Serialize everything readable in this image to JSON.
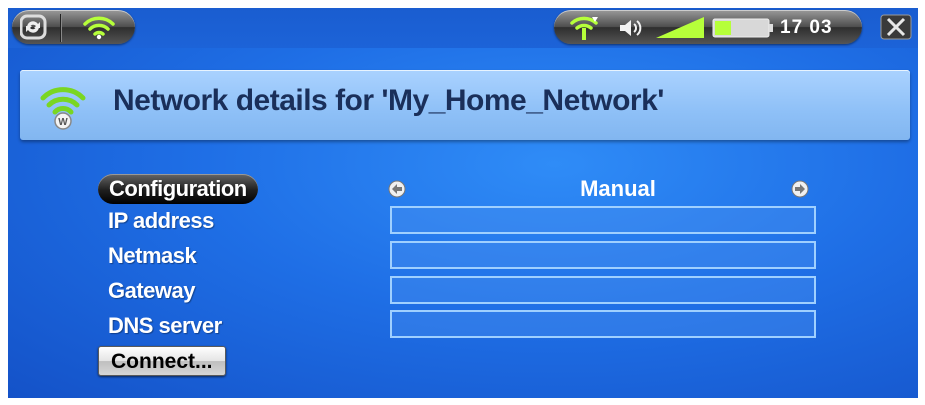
{
  "status_bar": {
    "left_icons": [
      "sync-icon",
      "wifi-icon"
    ],
    "right_icons": [
      "wifi-connected-icon",
      "volume-icon",
      "signal-level-icon",
      "battery-icon"
    ],
    "clock": "17 03",
    "close_icon": "close-icon"
  },
  "title": {
    "icon": "wifi-network-icon",
    "text": "Network details for 'My_Home_Network'"
  },
  "form": {
    "configuration": {
      "label": "Configuration",
      "value": "Manual",
      "left_arrow": "arrow-left-icon",
      "right_arrow": "arrow-right-icon"
    },
    "fields": [
      {
        "label": "IP address",
        "value": ""
      },
      {
        "label": "Netmask",
        "value": ""
      },
      {
        "label": "Gateway",
        "value": ""
      },
      {
        "label": "DNS server",
        "value": ""
      }
    ],
    "connect_button": "Connect..."
  },
  "colors": {
    "background": "#1f6fe6",
    "title_panel": "#9cc9fb",
    "title_text": "#1a2f5a",
    "field_border": "#9fd0ff"
  }
}
